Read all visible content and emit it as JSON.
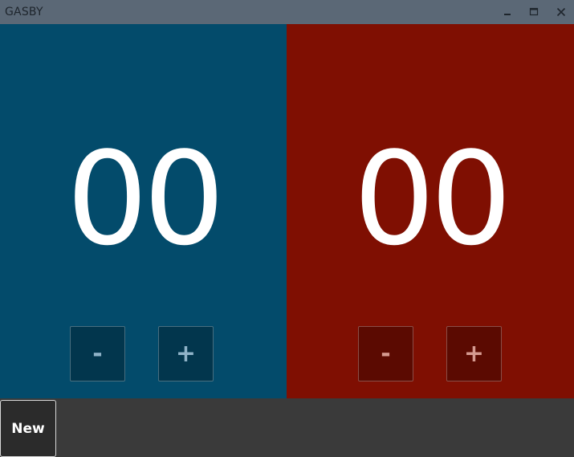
{
  "window": {
    "title": "GASBY",
    "controls": {
      "minimize_icon": "minimize-icon",
      "maximize_icon": "maximize-icon",
      "close_icon": "close-icon"
    }
  },
  "teams": [
    {
      "score": "00",
      "color": "#034b6b",
      "minus_label": "-",
      "plus_label": "+"
    },
    {
      "score": "00",
      "color": "#7f0f02",
      "minus_label": "-",
      "plus_label": "+"
    }
  ],
  "bottom": {
    "new_label": "New"
  },
  "colors": {
    "titlebar": "#5b6876",
    "bottombar": "#3a3a3a"
  }
}
